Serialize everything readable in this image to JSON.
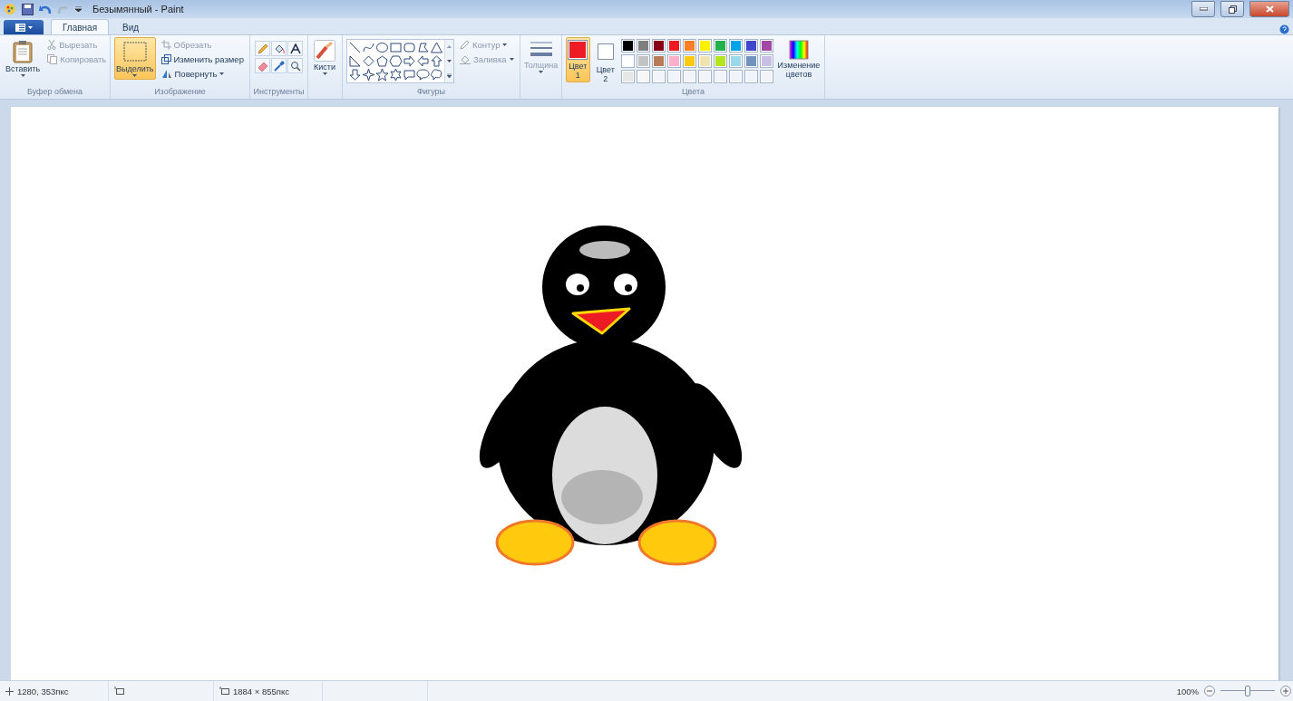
{
  "window": {
    "title": "Безымянный - Paint"
  },
  "tabs": [
    {
      "label": "Главная",
      "selected": true
    },
    {
      "label": "Вид",
      "selected": false
    }
  ],
  "clipboard": {
    "paste": "Вставить",
    "cut": {
      "label": "Вырезать",
      "disabled": true
    },
    "copy": {
      "label": "Копировать",
      "disabled": true
    },
    "caption": "Буфер обмена"
  },
  "image": {
    "select": {
      "label": "Выделить",
      "selected": true
    },
    "crop": {
      "label": "Обрезать",
      "disabled": true
    },
    "resize": {
      "label": "Изменить размер",
      "disabled": false
    },
    "rotate": {
      "label": "Повернуть",
      "disabled": false
    },
    "caption": "Изображение"
  },
  "tools": {
    "caption": "Инструменты"
  },
  "brushes": {
    "label": "Кисти"
  },
  "shapes": {
    "outline": {
      "label": "Контур",
      "disabled": true
    },
    "fill": {
      "label": "Заливка",
      "disabled": true
    },
    "caption": "Фигуры"
  },
  "thickness": {
    "label": "Толщина",
    "disabled": true
  },
  "colors": {
    "color1": {
      "label": "Цвет",
      "number": "1",
      "color": "#ed1c24",
      "selected": true
    },
    "color2": {
      "label": "Цвет",
      "number": "2",
      "color": "#ffffff",
      "selected": false
    },
    "edit": "Изменение цветов",
    "caption": "Цвета",
    "palette": [
      {
        "kind": "swatch",
        "color": "#000000"
      },
      {
        "kind": "swatch",
        "color": "#7f7f7f"
      },
      {
        "kind": "swatch",
        "color": "#880015"
      },
      {
        "kind": "swatch",
        "color": "#ed1c24"
      },
      {
        "kind": "swatch",
        "color": "#ff7f27"
      },
      {
        "kind": "swatch",
        "color": "#fff200"
      },
      {
        "kind": "swatch",
        "color": "#22b14c"
      },
      {
        "kind": "swatch",
        "color": "#00a2e8"
      },
      {
        "kind": "swatch",
        "color": "#3f48cc"
      },
      {
        "kind": "swatch",
        "color": "#a349a4"
      },
      {
        "kind": "swatch",
        "color": "#ffffff"
      },
      {
        "kind": "swatch",
        "color": "#c3c3c3"
      },
      {
        "kind": "swatch",
        "color": "#b97a57"
      },
      {
        "kind": "swatch",
        "color": "#ffaec9"
      },
      {
        "kind": "swatch",
        "color": "#ffc90e"
      },
      {
        "kind": "swatch",
        "color": "#efe4b0"
      },
      {
        "kind": "swatch",
        "color": "#b5e61d"
      },
      {
        "kind": "swatch",
        "color": "#99d9ea"
      },
      {
        "kind": "swatch",
        "color": "#7092be"
      },
      {
        "kind": "swatch",
        "color": "#c8bfe7"
      },
      {
        "kind": "swatch",
        "color": "#e6e6e6"
      },
      {
        "kind": "swatch",
        "color": "#f7f7f7"
      },
      {
        "kind": "empty"
      },
      {
        "kind": "empty"
      },
      {
        "kind": "empty"
      },
      {
        "kind": "empty"
      },
      {
        "kind": "empty"
      },
      {
        "kind": "empty"
      },
      {
        "kind": "empty"
      },
      {
        "kind": "empty"
      }
    ]
  },
  "status_bar": {
    "cursor": "1280, 353пкс",
    "size": "1884 × 855пкс",
    "zoom": "100%",
    "zoom_slider": {
      "level": 0.5
    }
  }
}
